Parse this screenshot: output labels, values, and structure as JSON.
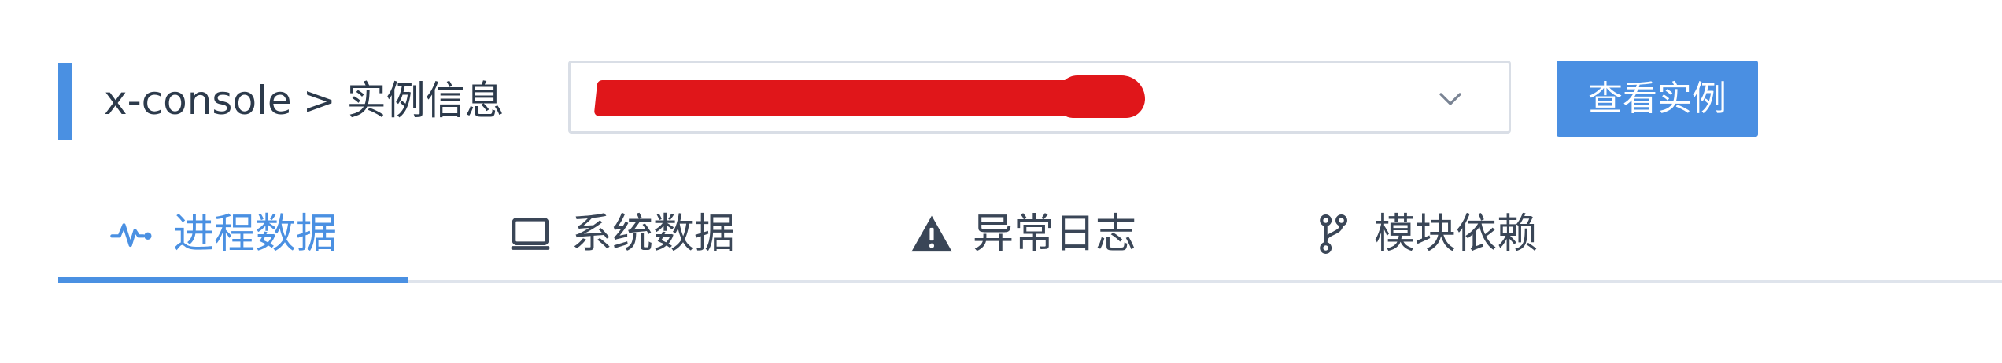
{
  "header": {
    "breadcrumb": {
      "app": "x-console",
      "separator": ">",
      "page": "实例信息"
    },
    "instance_select": {
      "value_redacted": true,
      "icon": "chevron-down-icon"
    },
    "view_instance_label": "查看实例"
  },
  "tabs": [
    {
      "label": "进程数据",
      "icon": "activity-pulse-icon",
      "active": true
    },
    {
      "label": "系统数据",
      "icon": "monitor-icon",
      "active": false
    },
    {
      "label": "异常日志",
      "icon": "warning-triangle-icon",
      "active": false
    },
    {
      "label": "模块依赖",
      "icon": "git-branch-icon",
      "active": false
    }
  ],
  "colors": {
    "accent": "#4a90e2",
    "text": "#2c3a4b",
    "border": "#d9dee6",
    "redaction": "#e0161a"
  }
}
